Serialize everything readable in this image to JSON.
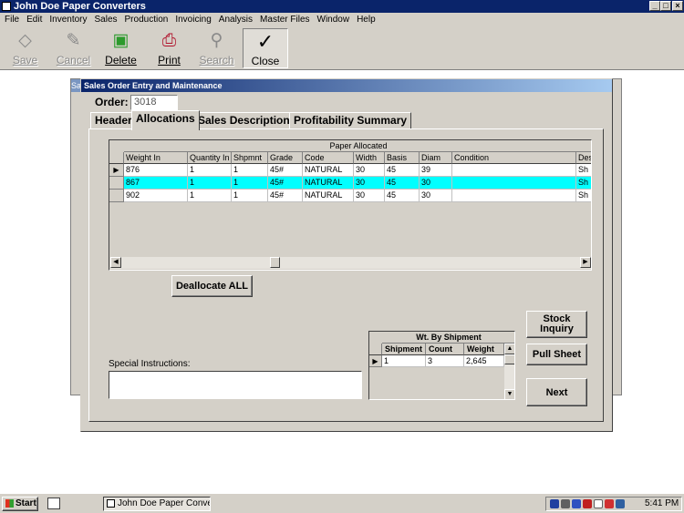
{
  "app": {
    "title": "John Doe Paper Converters"
  },
  "menu": [
    "File",
    "Edit",
    "Inventory",
    "Sales",
    "Production",
    "Invoicing",
    "Analysis",
    "Master Files",
    "Window",
    "Help"
  ],
  "toolbar": {
    "save": "Save",
    "cancel": "Cancel",
    "delete": "Delete",
    "print": "Print",
    "search": "Search",
    "close": "Close"
  },
  "background_window": {
    "title_fragment": "Sa"
  },
  "dialog": {
    "title": "Sales Order Entry and Maintenance",
    "order_label": "Order:",
    "order_value": "3018",
    "tabs": [
      "Header",
      "Allocations",
      "Sales Descriptions",
      "Profitability Summary"
    ],
    "active_tab": "Allocations"
  },
  "allocated_grid": {
    "caption": "Paper Allocated",
    "columns": [
      "Weight In",
      "Quantity In",
      "Shpmnt",
      "Grade",
      "Code",
      "Width",
      "Basis",
      "Diam",
      "Condition",
      "Des"
    ],
    "rows": [
      [
        "876",
        "1",
        "1",
        "45#",
        "NATURAL",
        "30",
        "45",
        "39",
        "",
        "Sh"
      ],
      [
        "867",
        "1",
        "1",
        "45#",
        "NATURAL",
        "30",
        "45",
        "30",
        "",
        "Sh"
      ],
      [
        "902",
        "1",
        "1",
        "45#",
        "NATURAL",
        "30",
        "45",
        "30",
        "",
        "Sh"
      ]
    ],
    "selected_row": 1,
    "highlight_color": "#00ffff"
  },
  "buttons": {
    "deallocate_all": "Deallocate ALL",
    "stock_inquiry": "Stock Inquiry",
    "pull_sheet": "Pull Sheet",
    "next": "Next"
  },
  "special_instructions": {
    "label": "Special Instructions:",
    "value": ""
  },
  "shipment_grid": {
    "caption": "Wt. By Shipment",
    "columns": [
      "Shipment",
      "Count",
      "Weight"
    ],
    "rows": [
      [
        "1",
        "3",
        "2,645"
      ]
    ]
  },
  "taskbar": {
    "start": "Start",
    "task": "John Doe Paper Conve...",
    "clock": "5:41 PM"
  }
}
